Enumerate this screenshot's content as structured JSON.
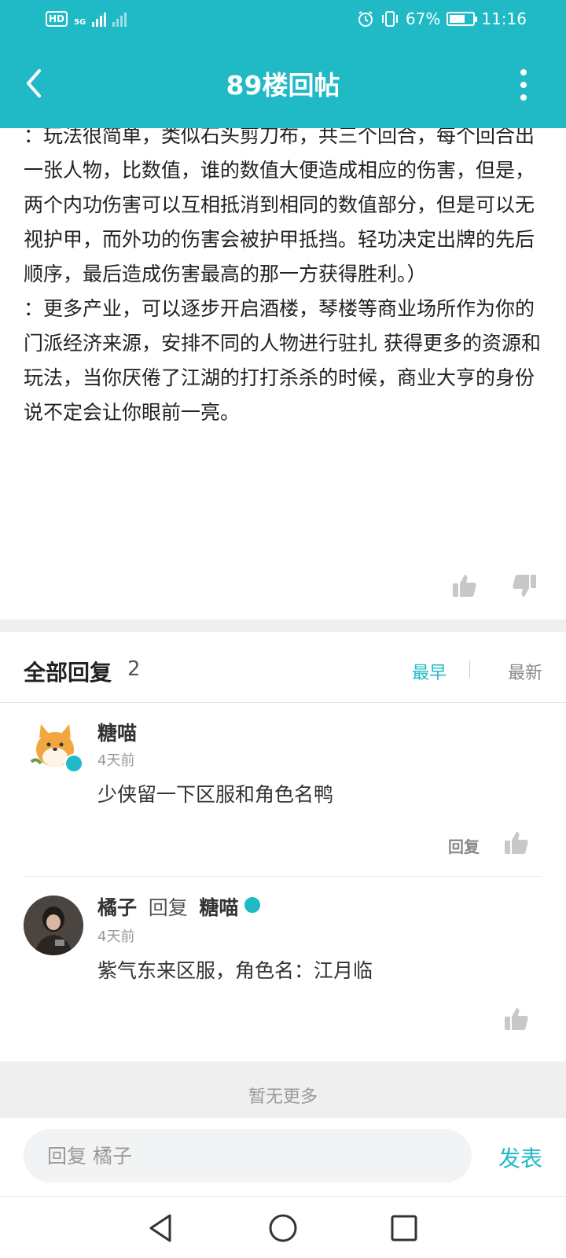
{
  "status_bar": {
    "hd": "HD",
    "network": "5G",
    "battery_text": "67%",
    "battery_level": 0.67,
    "time": "11:16"
  },
  "header": {
    "title": "89楼回帖"
  },
  "post": {
    "paragraphs": [
      "：玩法很简单，类似石头剪刀布，共三个回合，每个回合出一张人物，比数值，谁的数值大便造成相应的伤害，但是，两个内功伤害可以互相抵消到相同的数值部分，但是可以无视护甲，而外功的伤害会被护甲抵挡。轻功决定出牌的先后顺序，最后造成伤害最高的那一方获得胜利。）",
      "：更多产业，可以逐步开启酒楼，琴楼等商业场所作为你的门派经济来源，安排不同的人物进行驻扎 获得更多的资源和玩法，当你厌倦了江湖的打打杀杀的时候，商业大亨的身份说不定会让你眼前一亮。"
    ]
  },
  "replies_header": {
    "title": "全部回复",
    "count": "2",
    "sort_earliest": "最早",
    "sort_newest": "最新"
  },
  "replies": [
    {
      "name": "糖喵",
      "time": "4天前",
      "text": "少侠留一下区服和角色名鸭",
      "reply_label": "回复"
    },
    {
      "name": "橘子",
      "reply_word": "回复",
      "reply_to": "糖喵",
      "time": "4天前",
      "text": "紫气东来区服，角色名：江月临"
    }
  ],
  "no_more": "暂无更多",
  "composer": {
    "placeholder": "回复 橘子",
    "publish": "发表"
  },
  "colors": {
    "accent": "#1fbac6",
    "background": "#ffffff",
    "band": "#efefef"
  }
}
